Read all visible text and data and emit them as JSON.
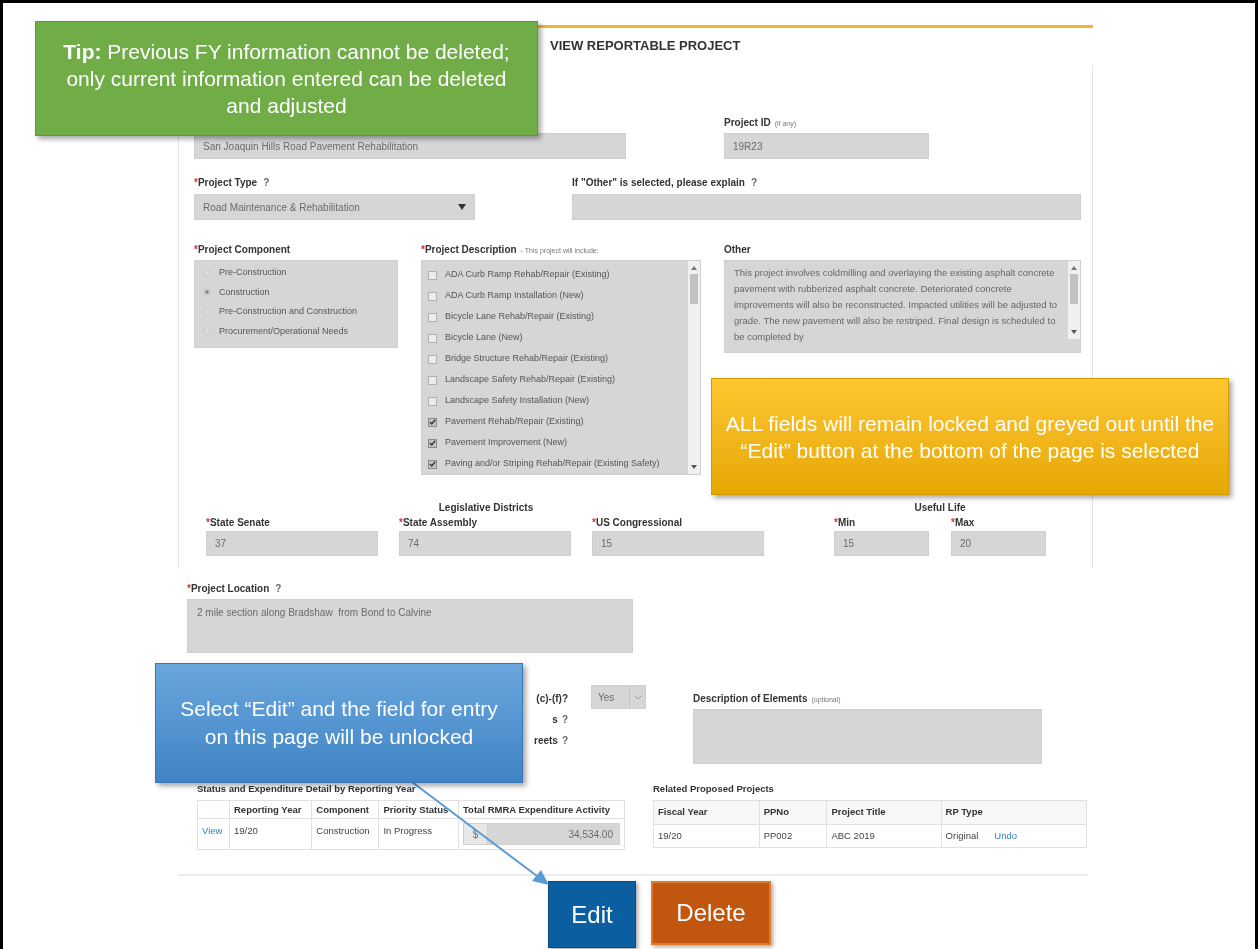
{
  "page_title": "VIEW REPORTABLE PROJECT",
  "required_mark": "*",
  "project_title": {
    "value": "San Joaquin Hills Road Pavement Rehabilitation"
  },
  "project_id": {
    "label": "Project ID",
    "note": "(if any)",
    "value": "19R23"
  },
  "project_type": {
    "label": "Project Type",
    "required": true,
    "help": "?",
    "value": "Road Maintenance & Rehabilitation"
  },
  "other_explain": {
    "label": "If \"Other\" is selected, please explain",
    "required": false,
    "help": "?"
  },
  "project_component": {
    "label": "Project Component",
    "required": true,
    "options": [
      {
        "label": "Pre-Construction",
        "selected": false
      },
      {
        "label": "Construction",
        "selected": true
      },
      {
        "label": "Pre-Construction and Construction",
        "selected": false
      },
      {
        "label": "Procurement/Operational Needs",
        "selected": false
      }
    ]
  },
  "project_description": {
    "label": "Project Description",
    "required": true,
    "note": "- This project will include:",
    "options": [
      {
        "label": "ADA Curb Ramp Rehab/Repair (Existing)",
        "checked": false
      },
      {
        "label": "ADA Curb Ramp Installation (New)",
        "checked": false
      },
      {
        "label": "Bicycle Lane Rehab/Repair (Existing)",
        "checked": false
      },
      {
        "label": "Bicycle Lane (New)",
        "checked": false
      },
      {
        "label": "Bridge Structure Rehab/Repair (Existing)",
        "checked": false
      },
      {
        "label": "Landscape Safety Rehab/Repair (Existing)",
        "checked": false
      },
      {
        "label": "Landscape Safety Installation (New)",
        "checked": false
      },
      {
        "label": "Pavement Rehab/Repair (Existing)",
        "checked": true
      },
      {
        "label": "Pavement Improvement (New)",
        "checked": true
      },
      {
        "label": "Paving and/or Striping Rehab/Repair (Existing Safety)",
        "checked": true
      }
    ]
  },
  "other": {
    "label": "Other",
    "value": "This project involves coldmilling and overlaying the existing asphalt concrete pavement with rubberized asphalt concrete. Deteriorated concrete improvements will also be reconstructed. Impacted utilities will be adjusted to grade. The new pavement will also be restriped. Final design is scheduled to be completed by"
  },
  "legislative_districts": {
    "title": "Legislative Districts",
    "fields": [
      {
        "label": "State Senate",
        "required": true,
        "value": "37"
      },
      {
        "label": "State Assembly",
        "required": true,
        "value": "74"
      },
      {
        "label": "US Congressional",
        "required": true,
        "value": "15"
      }
    ]
  },
  "useful_life": {
    "title": "Useful Life",
    "fields": [
      {
        "label": "Min",
        "required": true,
        "value": "15"
      },
      {
        "label": "Max",
        "required": true,
        "value": "20"
      }
    ]
  },
  "project_location": {
    "label": "Project Location",
    "required": true,
    "help": "?",
    "value": "2 mile section along Bradshaw  from Bond to Calvine"
  },
  "question_fragments": [
    {
      "text": "(c)-(f)?"
    },
    {
      "text": "s",
      "help": "?"
    },
    {
      "text": "reets",
      "help": "?"
    }
  ],
  "answer_select": {
    "value": "Yes"
  },
  "description_of_elements": {
    "label": "Description of Elements",
    "note": "(optional)"
  },
  "expenditure_table": {
    "title": "Status and Expenditure Detail by Reporting Year",
    "columns": [
      "Reporting Year",
      "Component",
      "Priority Status",
      "Total RMRA Expenditure Activity"
    ],
    "rows": [
      {
        "link": "View",
        "reporting_year": "19/20",
        "component": "Construction",
        "priority_status": "In Progress",
        "currency": "$",
        "amount": "34,534.00"
      }
    ]
  },
  "related_table": {
    "title": "Related Proposed Projects",
    "columns": [
      "Fiscal Year",
      "PPNo",
      "Project Title",
      "RP Type"
    ],
    "rows": [
      {
        "cells": [
          "19/20",
          "PP002",
          "ABC 2019",
          "Original"
        ],
        "action": "Undo"
      }
    ]
  },
  "buttons": [
    {
      "label": "Edit",
      "kind": "edit"
    },
    {
      "label": "Delete",
      "kind": "delete"
    }
  ],
  "callouts": [
    {
      "kind": "tip",
      "text": "**Tip:** Previous FY information cannot be deleted; only current information entered can be deleted and adjusted"
    },
    {
      "kind": "warning",
      "text": "ALL fields will remain locked and greyed out until the “Edit” button at the bottom of the page is selected"
    },
    {
      "kind": "info",
      "text": "Select “Edit” and the field for entry on this page will be unlocked"
    }
  ]
}
